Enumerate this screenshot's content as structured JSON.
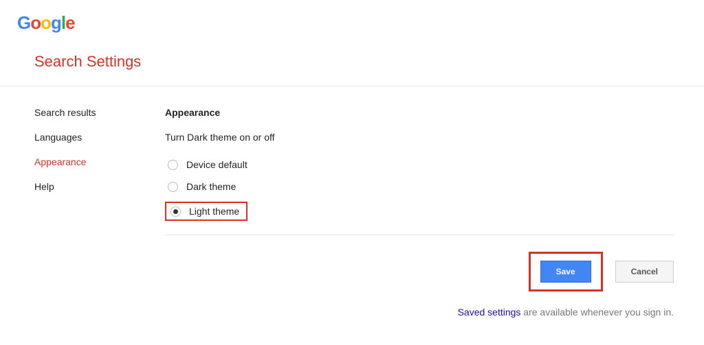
{
  "logo": {
    "g1": "G",
    "o1": "o",
    "o2": "o",
    "g2": "g",
    "l": "l",
    "e": "e"
  },
  "page_title": "Search Settings",
  "sidebar": {
    "items": [
      {
        "label": "Search results",
        "active": false
      },
      {
        "label": "Languages",
        "active": false
      },
      {
        "label": "Appearance",
        "active": true
      },
      {
        "label": "Help",
        "active": false
      }
    ]
  },
  "main": {
    "section_title": "Appearance",
    "section_sub": "Turn Dark theme on or off",
    "options": [
      {
        "label": "Device default",
        "selected": false
      },
      {
        "label": "Dark theme",
        "selected": false
      },
      {
        "label": "Light theme",
        "selected": true
      }
    ],
    "save_label": "Save",
    "cancel_label": "Cancel"
  },
  "footer": {
    "link_text": "Saved settings",
    "rest_text": " are available whenever you sign in."
  }
}
